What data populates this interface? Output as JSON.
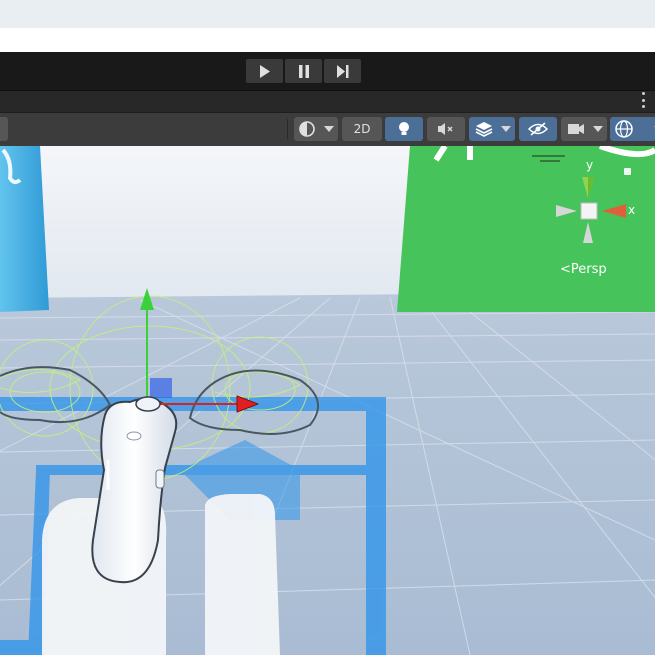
{
  "playmode": {
    "play_icon": "play-icon",
    "pause_icon": "pause-icon",
    "step_icon": "step-icon"
  },
  "toolbar": {
    "shading_icon": "shading-mode-icon",
    "mode_2d_label": "2D",
    "lighting_icon": "lighting-bulb-icon",
    "audio_icon": "audio-mute-icon",
    "effects_icon": "effects-layers-icon",
    "visibility_icon": "scene-visibility-icon",
    "camera_icon": "scene-camera-icon",
    "gizmos_icon": "gizmos-globe-icon"
  },
  "orientation_gizmo": {
    "y_label": "y",
    "x_label": "x",
    "projection_label": "Persp"
  },
  "colors": {
    "toolbar_bg": "#3c3c3c",
    "toggle_active": "#4c6f98",
    "green_panel": "#46c35a",
    "blue_panel": "#3aa5da",
    "selection_blue": "#2e8fe8"
  }
}
